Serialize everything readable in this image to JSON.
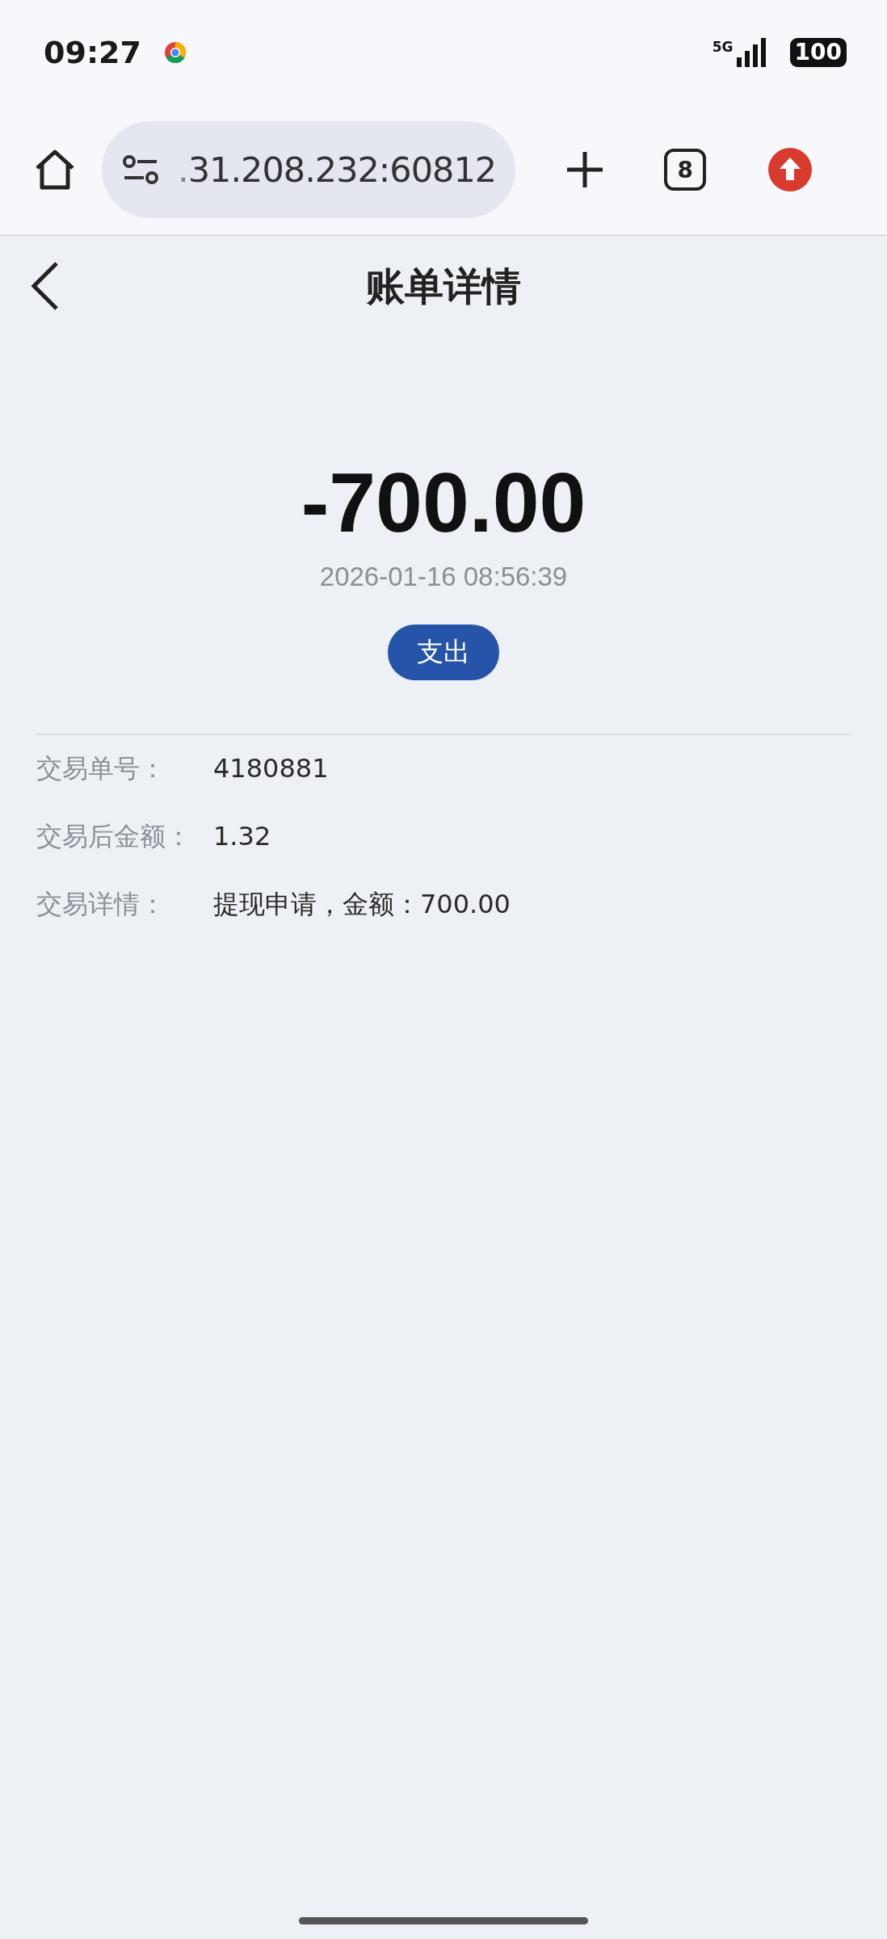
{
  "status_bar": {
    "time": "09:27",
    "network": "5G",
    "battery": "100"
  },
  "browser": {
    "url": ".31.208.232:60812",
    "tab_count": "8"
  },
  "header": {
    "title": "账单详情"
  },
  "summary": {
    "amount": "-700.00",
    "datetime": "2026-01-16 08:56:39",
    "type_badge": "支出"
  },
  "details": [
    {
      "label": "交易单号：",
      "value": "4180881"
    },
    {
      "label": "交易后金额：",
      "value": "1.32"
    },
    {
      "label": "交易详情：",
      "value": "提现申请，金额：700.00"
    }
  ]
}
